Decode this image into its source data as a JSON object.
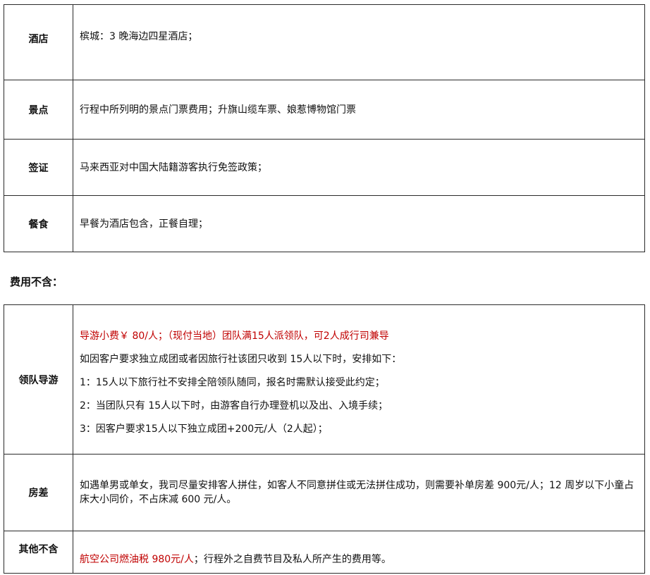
{
  "included_table": {
    "rows": [
      {
        "label": "酒店",
        "text": "槟城：3 晚海边四星酒店；"
      },
      {
        "label": "景点",
        "text": "行程中所列明的景点门票费用；升旗山缆车票、娘惹博物馆门票"
      },
      {
        "label": "签证",
        "text": "马来西亚对中国大陆籍游客执行免签政策；"
      },
      {
        "label": "餐食",
        "text": "早餐为酒店包含，正餐自理；"
      }
    ]
  },
  "section_title": "费用不含：",
  "excluded_table": {
    "guide": {
      "label": "领队导游",
      "red_line": "导游小费￥ 80/人；（现付当地）团队满15人派领队，可2人成行司兼导",
      "lines": [
        "如因客户要求独立成团或者因旅行社该团只收到 15人以下时，安排如下：",
        "1：15人以下旅行社不安排全陪领队随同，报名时需默认接受此约定；",
        "2：当团队只有 15人以下时，由游客自行办理登机以及出、入境手续；",
        "3：因客户要求15人以下独立成团+200元/人（2人起）；"
      ]
    },
    "room": {
      "label": "房差",
      "text": "如遇单男或单女，我司尽量安排客人拼住，如客人不同意拼住或无法拼住成功，则需要补单房差 900元/人；12 周岁以下小童占床大小同价，不占床减 600 元/人。"
    },
    "other": {
      "label": "其他不含",
      "red_text": "航空公司燃油税 980元/人",
      "text": "；行程外之自费节目及私人所产生的费用等。"
    }
  }
}
